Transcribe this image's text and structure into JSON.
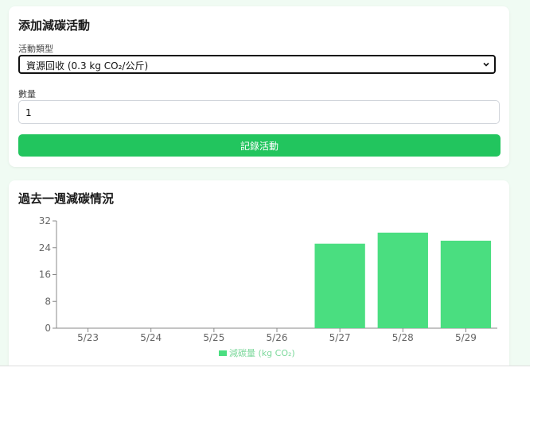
{
  "form": {
    "title": "添加減碳活動",
    "activity_label": "活動類型",
    "activity_selected": "資源回收 (0.3 kg CO₂/公斤)",
    "quantity_label": "數量",
    "quantity_value": "1",
    "submit_label": "記錄活動"
  },
  "chart_section": {
    "title": "過去一週減碳情況"
  },
  "colors": {
    "accent": "#22c55e",
    "bar": "#4ade80",
    "page_background": "#f0fbf3"
  },
  "chart_data": {
    "type": "bar",
    "categories": [
      "5/23",
      "5/24",
      "5/25",
      "5/26",
      "5/27",
      "5/28",
      "5/29"
    ],
    "series": [
      {
        "name": "減碳量 (kg CO₂)",
        "values": [
          0,
          0,
          0,
          0,
          25.2,
          28.5,
          26.1
        ]
      }
    ],
    "yticks": [
      0,
      8,
      16,
      24,
      32
    ],
    "ylim": [
      0,
      32
    ],
    "grid": false,
    "legend": "bottom"
  }
}
